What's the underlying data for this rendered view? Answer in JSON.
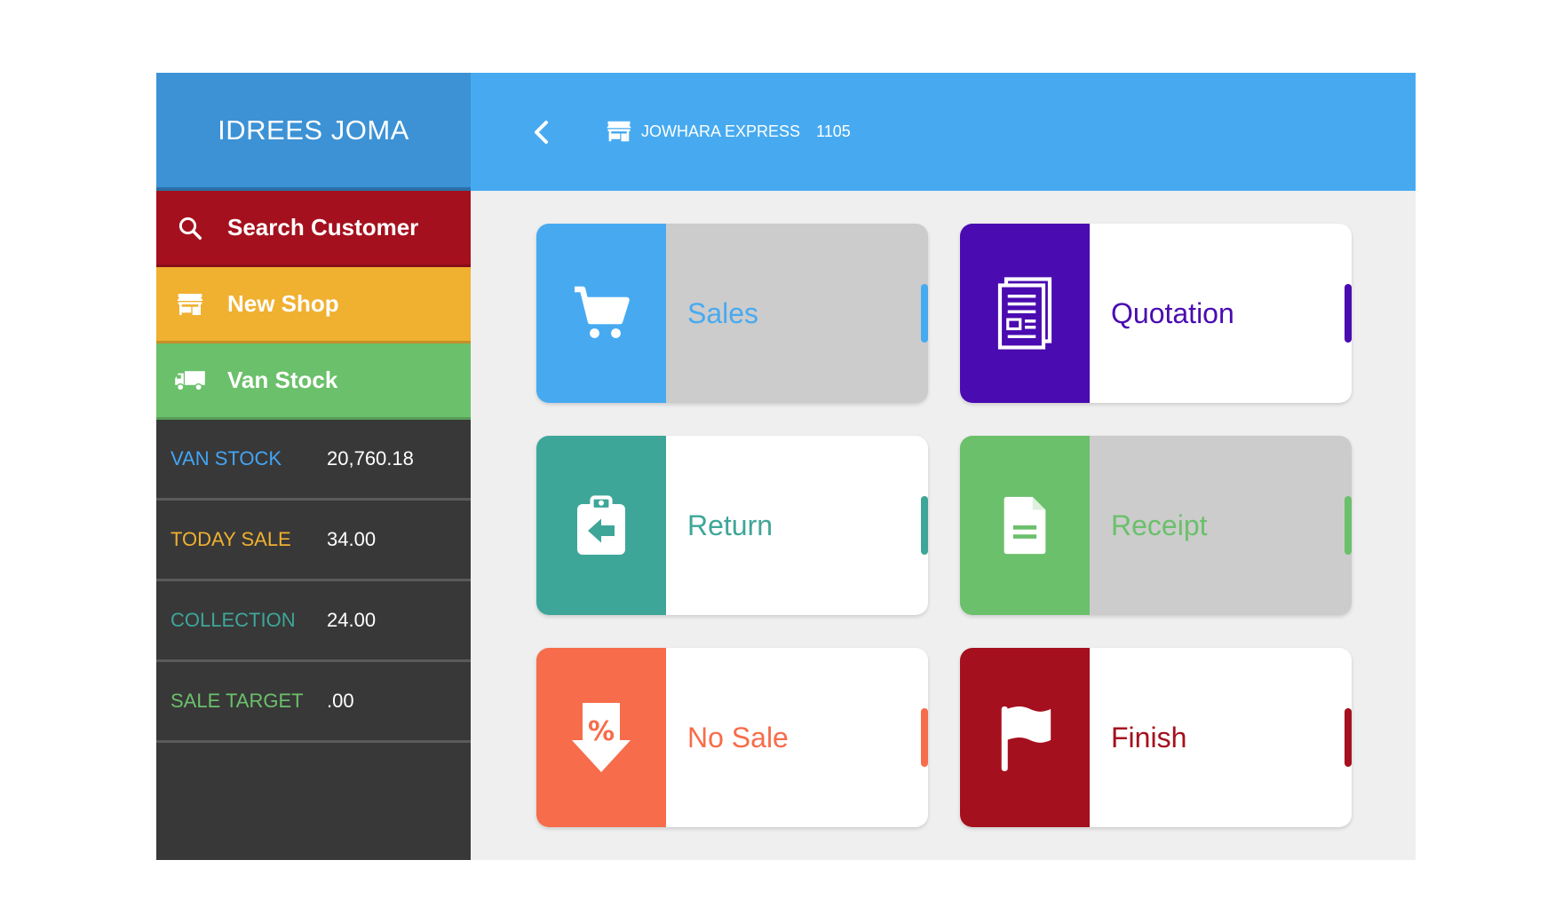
{
  "user": {
    "name": "IDREES JOMA"
  },
  "nav": {
    "search_customer": "Search Customer",
    "new_shop": "New Shop",
    "van_stock": "Van Stock"
  },
  "stats": [
    {
      "label": "VAN STOCK",
      "value": "20,760.18",
      "color": "#42a5f5"
    },
    {
      "label": "TODAY SALE",
      "value": "34.00",
      "color": "#f0b030"
    },
    {
      "label": "COLLECTION",
      "value": "24.00",
      "color": "#3ea699"
    },
    {
      "label": "SALE TARGET",
      "value": ".00",
      "color": "#6bc06b"
    }
  ],
  "header": {
    "shop_name": "JOWHARA EXPRESS",
    "shop_code": "1105"
  },
  "tiles": {
    "sales": {
      "label": "Sales",
      "color": "#47aaf0",
      "icon": "cart-icon"
    },
    "quotation": {
      "label": "Quotation",
      "color": "#4a0bb0",
      "icon": "document-list-icon"
    },
    "return": {
      "label": "Return",
      "color": "#3ea699",
      "icon": "clipboard-return-icon"
    },
    "receipt": {
      "label": "Receipt",
      "color": "#6bc06b",
      "icon": "file-icon"
    },
    "no_sale": {
      "label": "No Sale",
      "color": "#f76c4a",
      "icon": "percent-down-icon"
    },
    "finish": {
      "label": "Finish",
      "color": "#a5101e",
      "icon": "flag-icon"
    }
  },
  "colors": {
    "sidebar_header": "#3c92d5",
    "topbar": "#47aaf0",
    "search_customer": "#a5101e",
    "new_shop": "#f0b030",
    "van_stock": "#6bc06b",
    "sidebar_bg": "#383838",
    "content_bg": "#efefef"
  }
}
